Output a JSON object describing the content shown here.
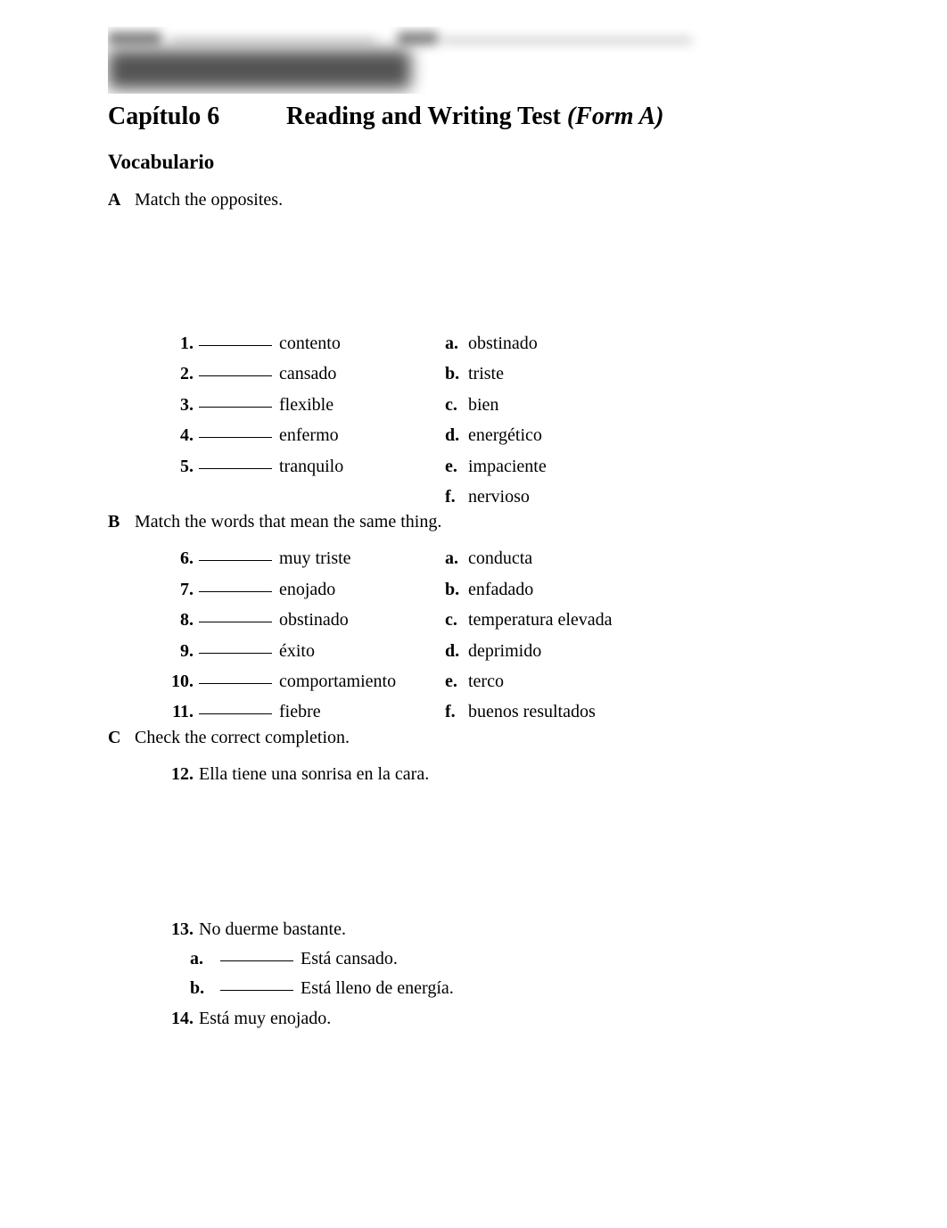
{
  "header": {
    "chapter": "Capítulo 6",
    "test_title": "Reading and Writing Test",
    "test_form": "(Form A)"
  },
  "section_title": "Vocabulario",
  "section_a": {
    "letter": "A",
    "instruction": "Match the opposites.",
    "items": [
      {
        "num": "1.",
        "word": "contento"
      },
      {
        "num": "2.",
        "word": "cansado"
      },
      {
        "num": "3.",
        "word": "flexible"
      },
      {
        "num": "4.",
        "word": "enfermo"
      },
      {
        "num": "5.",
        "word": "tranquilo"
      }
    ],
    "options": [
      {
        "letter": "a.",
        "word": "obstinado"
      },
      {
        "letter": "b.",
        "word": "triste"
      },
      {
        "letter": "c.",
        "word": "bien"
      },
      {
        "letter": "d.",
        "word": "energético"
      },
      {
        "letter": "e.",
        "word": "impaciente"
      },
      {
        "letter": "f.",
        "word": "nervioso"
      }
    ]
  },
  "section_b": {
    "letter": "B",
    "instruction": "Match the words that mean the same thing.",
    "items": [
      {
        "num": "6.",
        "word": "muy triste"
      },
      {
        "num": "7.",
        "word": "enojado"
      },
      {
        "num": "8.",
        "word": "obstinado"
      },
      {
        "num": "9.",
        "word": "éxito"
      },
      {
        "num": "10.",
        "word": "comportamiento"
      },
      {
        "num": "11.",
        "word": "fiebre"
      }
    ],
    "options": [
      {
        "letter": "a.",
        "word": "conducta"
      },
      {
        "letter": "b.",
        "word": "enfadado"
      },
      {
        "letter": "c.",
        "word": "temperatura elevada"
      },
      {
        "letter": "d.",
        "word": "deprimido"
      },
      {
        "letter": "e.",
        "word": "terco"
      },
      {
        "letter": "f.",
        "word": "buenos resultados"
      }
    ]
  },
  "section_c": {
    "letter": "C",
    "instruction": "Check the correct completion.",
    "questions": [
      {
        "num": "12.",
        "text": "Ella tiene una sonrisa en la cara.",
        "choices": []
      },
      {
        "num": "13.",
        "text": "No duerme bastante.",
        "choices": [
          {
            "letter": "a.",
            "text": "Está cansado."
          },
          {
            "letter": "b.",
            "text": "Está lleno de energía."
          }
        ]
      },
      {
        "num": "14.",
        "text": "Está muy enojado.",
        "choices": []
      }
    ]
  }
}
